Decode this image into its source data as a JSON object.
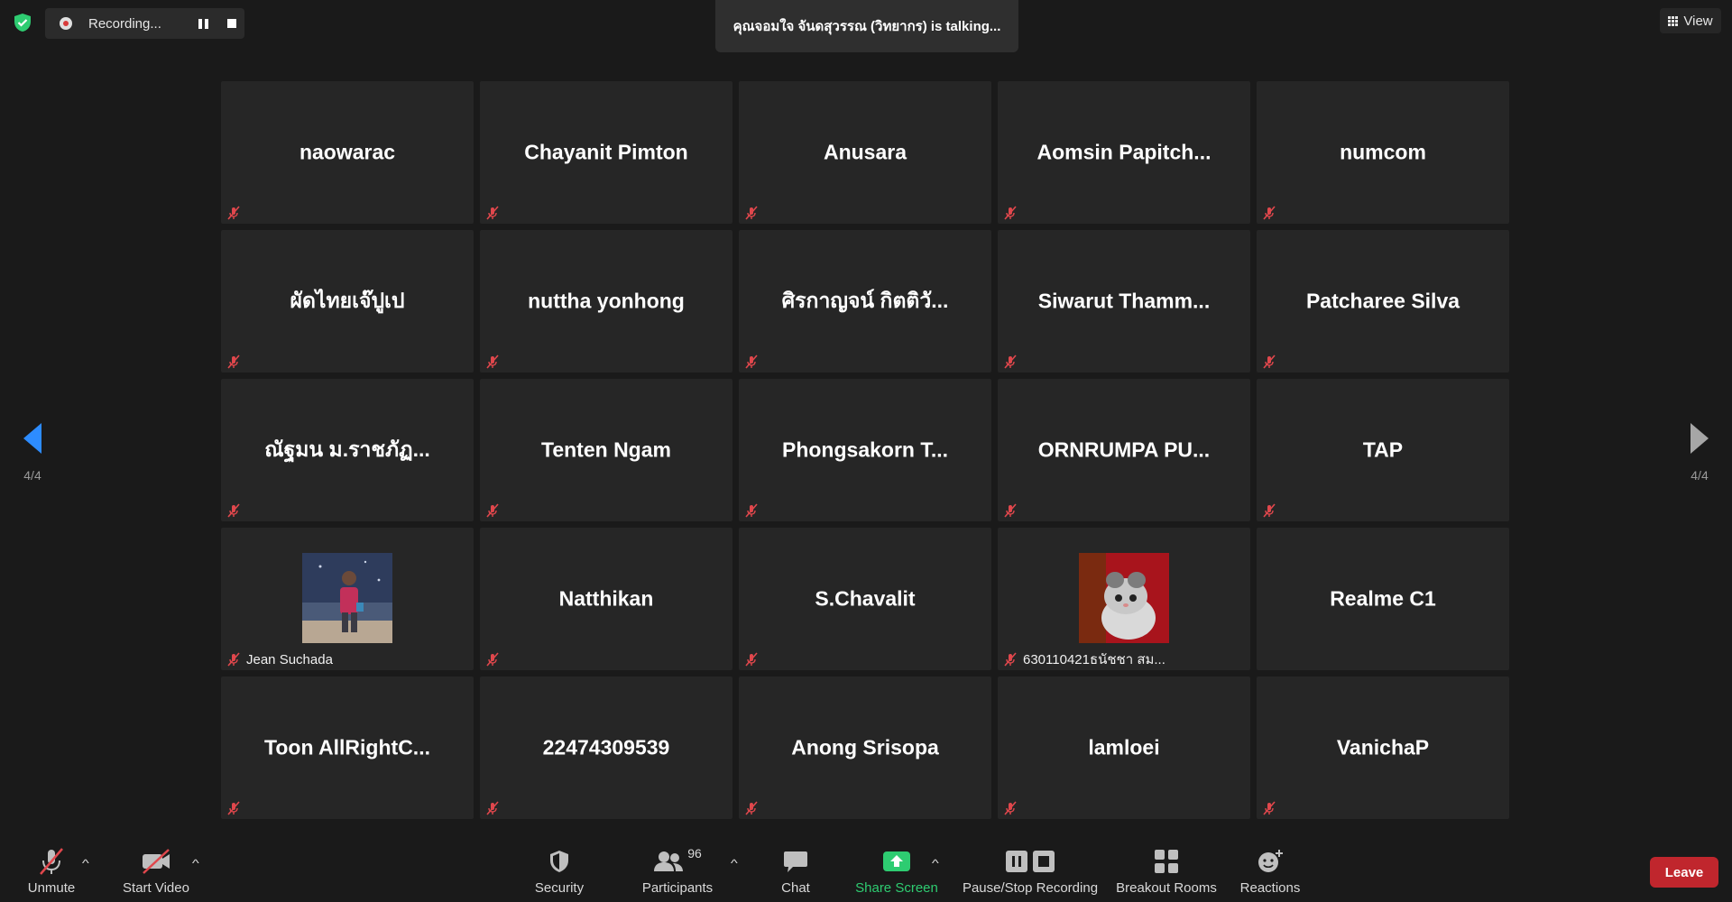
{
  "top": {
    "recording_label": "Recording...",
    "talking_text": "คุณจอมใจ จันดสุวรรณ (วิทยากร) is talking...",
    "view_label": "View"
  },
  "nav": {
    "left_page": "4/4",
    "right_page": "4/4"
  },
  "tiles": [
    {
      "name": "naowarac"
    },
    {
      "name": "Chayanit Pimton"
    },
    {
      "name": "Anusara"
    },
    {
      "name": "Aomsin  Papitch..."
    },
    {
      "name": "numcom"
    },
    {
      "name": "ผัดไทยเจ๊ปูเป"
    },
    {
      "name": "nuttha yonhong"
    },
    {
      "name": "ศิรกาญจน์ กิตติวั..."
    },
    {
      "name": "Siwarut  Thamm..."
    },
    {
      "name": "Patcharee Silva"
    },
    {
      "name": "ณัฐมน  ม.ราชภัฏ..."
    },
    {
      "name": "Tenten Ngam"
    },
    {
      "name": "Phongsakorn  T..."
    },
    {
      "name": "ORNRUMPA  PU..."
    },
    {
      "name": "TAP"
    },
    {
      "footer_name": "Jean Suchada"
    },
    {
      "name": "Natthikan"
    },
    {
      "name": "S.Chavalit"
    },
    {
      "footer_name": "630110421ธนัชชา สม..."
    },
    {
      "name": "Realme C1"
    },
    {
      "name": "Toon  AllRightC..."
    },
    {
      "name": "22474309539"
    },
    {
      "name": "Anong Srisopa"
    },
    {
      "name": "lamloei"
    },
    {
      "name": "VanichaP"
    }
  ],
  "toolbar": {
    "unmute_label": "Unmute",
    "start_video_label": "Start Video",
    "security_label": "Security",
    "participants_label": "Participants",
    "participants_count": "96",
    "chat_label": "Chat",
    "share_screen_label": "Share Screen",
    "pause_stop_recording_label": "Pause/Stop Recording",
    "breakout_rooms_label": "Breakout Rooms",
    "reactions_label": "Reactions",
    "leave_label": "Leave"
  },
  "colors": {
    "background": "#1a1a1a",
    "tile": "#262626",
    "leave_button": "#c0262d",
    "share_screen_green": "#2ecc71",
    "muted_red": "#e0474c",
    "nav_arrow_blue": "#2d8cff"
  },
  "icons": {
    "security": "shield-check-icon",
    "muted": "muted-mic-icon",
    "video_off": "video-off-icon",
    "participants": "people-icon",
    "chat": "chat-bubble-icon",
    "share": "share-screen-arrow-icon",
    "recording": "pause-stop-icon",
    "breakout": "breakout-rooms-grid-icon",
    "reactions": "smiley-plus-icon"
  }
}
